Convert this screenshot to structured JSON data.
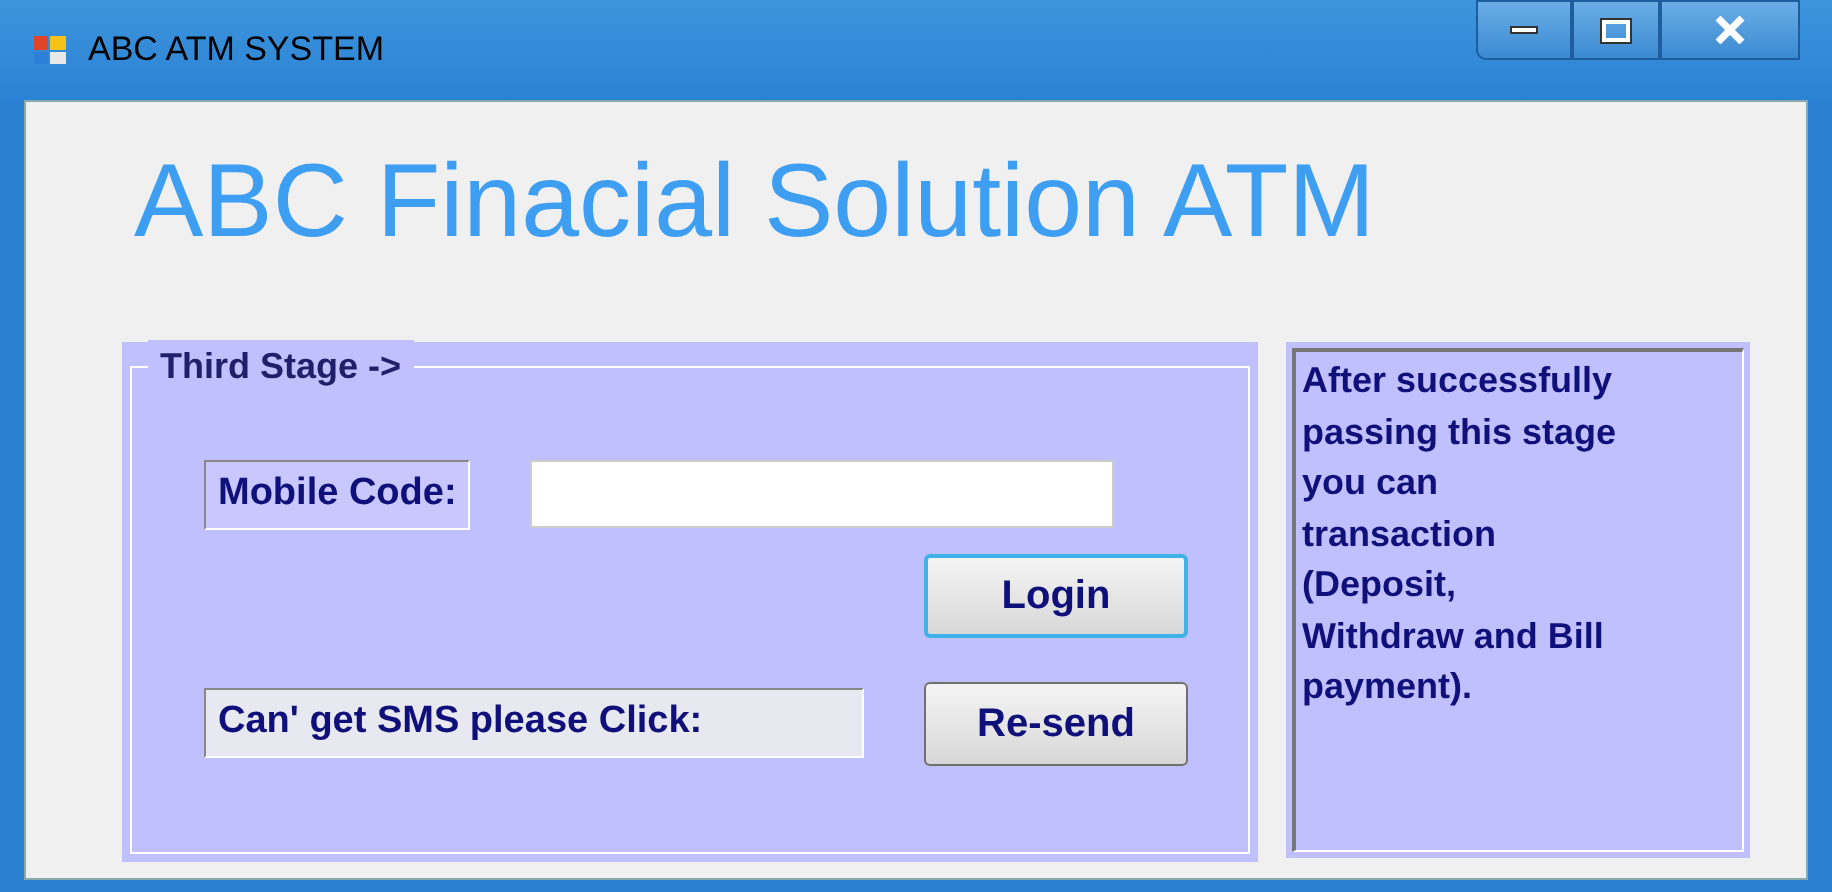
{
  "window": {
    "title": "ABC ATM SYSTEM"
  },
  "heading": "ABC Finacial Solution ATM",
  "stage_group": {
    "title": "Third Stage ->",
    "mobile_code": {
      "label": "Mobile Code:"
    },
    "buttons": [
      {
        "label": "Login",
        "focused": true
      },
      {
        "label": "Re-send",
        "focused": false
      }
    ],
    "resend_label": "Can' get SMS please Click:"
  },
  "info": "After successfully\npassing this stage\nyou can\ntransaction\n(Deposit,\nWithdraw and Bill\npayment)."
}
